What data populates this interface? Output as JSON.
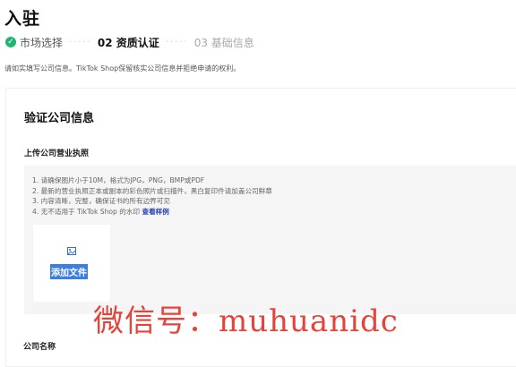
{
  "header": {
    "title": "入驻"
  },
  "steps": [
    {
      "label": "市场选择",
      "state": "done"
    },
    {
      "label": "02 资质认证",
      "state": "active"
    },
    {
      "label": "03 基础信息",
      "state": "upcoming"
    }
  ],
  "steps_divider": "·····",
  "notice": "请如实填写公司信息。TikTok Shop保留核实公司信息并拒绝申请的权利。",
  "card": {
    "title": "验证公司信息",
    "upload_label": "上传公司营业执照",
    "requirements": [
      "1. 请确保图片小于10M，格式为JPG，PNG，BMP或PDF",
      "2. 最新的营业执照正本或副本的彩色照片或扫描件，黑白复印件请加盖公司鲜章",
      "3. 内容清晰，完整，确保证书的所有边界可见",
      "4. 无不适用于 TikTok Shop 的水印"
    ],
    "example_link": "查看样例",
    "add_file": "添加文件",
    "company_name_label": "公司名称"
  },
  "watermark": "微信号：muhuanidc",
  "colors": {
    "success": "#21b573",
    "link": "#2a3fb5",
    "selection": "#3d7fe0",
    "watermark": "#e8433a"
  }
}
